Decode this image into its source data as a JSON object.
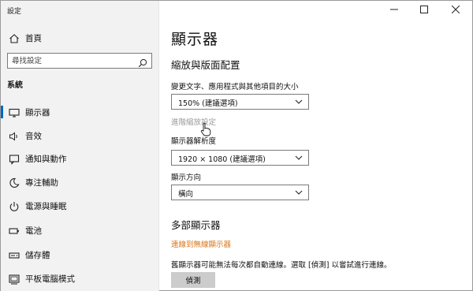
{
  "window": {
    "title": "設定",
    "controls": [
      "minimize",
      "maximize",
      "close"
    ]
  },
  "sidebar": {
    "home_label": "首頁",
    "search_placeholder": "尋找設定",
    "section_title": "系統",
    "items": [
      {
        "label": "顯示器",
        "icon": "monitor-icon",
        "selected": true
      },
      {
        "label": "音效",
        "icon": "speaker-icon"
      },
      {
        "label": "通知與動作",
        "icon": "notification-icon"
      },
      {
        "label": "專注輔助",
        "icon": "moon-icon"
      },
      {
        "label": "電源與睡眠",
        "icon": "power-icon"
      },
      {
        "label": "電池",
        "icon": "battery-icon"
      },
      {
        "label": "儲存體",
        "icon": "storage-icon"
      },
      {
        "label": "平板電腦模式",
        "icon": "tablet-icon"
      }
    ]
  },
  "main": {
    "title": "顯示器",
    "scale_section": {
      "heading": "縮放與版面配置",
      "text_size_label": "變更文字、應用程式與其他項目的大小",
      "text_size_value": "150% (建議選項)",
      "advanced_link": "進階縮放設定",
      "resolution_label": "顯示器解析度",
      "resolution_value": "1920 × 1080 (建議選項)",
      "orientation_label": "顯示方向",
      "orientation_value": "橫向"
    },
    "multi_section": {
      "heading": "多部顯示器",
      "wireless_link": "連線到無線顯示器",
      "description": "舊顯示器可能無法每次都自動連線。選取 [偵測] 以嘗試進行連線。",
      "detect_button": "偵測"
    }
  },
  "colors": {
    "accent": "#0067c0",
    "link_orange": "#d9761b",
    "sidebar_bg": "#f2f2f2"
  }
}
